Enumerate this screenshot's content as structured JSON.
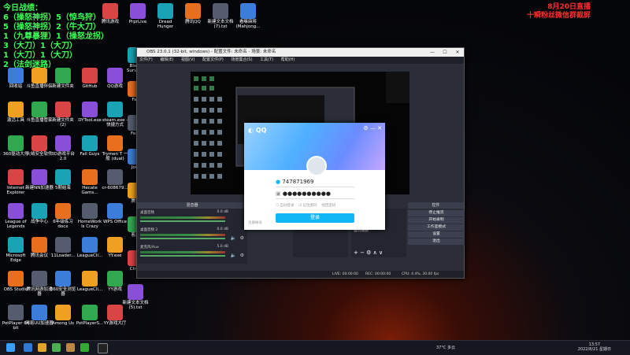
{
  "overlay": {
    "left_lines": [
      "今日战绩：",
      "6（操怒神拐）5（惊鸟狩）",
      "5（操怒神拐）2（牛大刀）",
      "1（九尊暴狸）1（操怒龙拐）",
      "3（大刀）1（大刀）",
      "1（大刀）1（大刀）",
      "2（法剑迷路）"
    ],
    "right_lines": [
      "8月20日直播",
      "十瞬粉丝微信群截屏"
    ]
  },
  "desktop": {
    "col1": [
      "回收站",
      "激活工具",
      "360驱动大师",
      "Internet Explorer",
      "League of Legends",
      "Microsoft Edge",
      "OBS Studio",
      "PotPlayer 64 bit"
    ],
    "col2": [
      "斗鱼直播伴侣",
      "斗鱼直播管家",
      "火绒安全软件",
      "新建NN加速器",
      "战争中心",
      "腾讯会议",
      "腾讯网游加速器",
      "网易UU加速器"
    ],
    "col3": [
      "新建文件夹",
      "新建文件夹 (2)",
      "3D游戏平台2.0",
      "5期结束",
      "6年级练习docx",
      "11Loader...",
      "360安全浏览器",
      "Among Us"
    ],
    "col4": [
      "GitHub",
      "DYTool.exe",
      "Fall Guys",
      "Hecate Gams...",
      "HomeWork Is Crazy",
      "LeagueCli...",
      "LeagueCli...",
      "PotPlayerS..."
    ],
    "col5": [
      "QQ游戏",
      "steam.exe - 快捷方式",
      "Trymen T 一般 (dual)",
      "cr-608679...",
      "WPS Office",
      "YY.exe",
      "YY游戏",
      "YY游戏大厅"
    ],
    "top_row": [
      "腾讯游戏",
      "PrprLive",
      "Dread Hunger",
      "腾讯QQ",
      "新建文本文档 (7).txt",
      "看嘛麻将(Mahjong..."
    ],
    "col6": [
      "Black Survival",
      "Fall",
      "Fear",
      "Jom",
      "腾讯",
      "客户",
      "Ctrl+",
      "新建文本文档 (5).txt"
    ],
    "col7": [
      "Pummel Party",
      "新建文本文档 (6).txt",
      "Google Chrome",
      "Riot Client"
    ]
  },
  "obs": {
    "title": "OBS 23.0.1 (32-bit, windows) - 配置文件: 未命名 - 场景: 未命名",
    "menu": [
      "文件(F)",
      "编辑(E)",
      "视图(V)",
      "配置文件(P)",
      "场景集合(S)",
      "工具(T)",
      "帮助(H)"
    ],
    "mixer_title": "混音器",
    "controls_title": "控件",
    "mixer_channels": [
      {
        "name": "桌面音频",
        "db": "0.0 dB"
      },
      {
        "name": "桌面音频 2",
        "db": "0.0 dB"
      },
      {
        "name": "麦克风/Aux",
        "db": "5.0 dB"
      }
    ],
    "sources": [
      "显示器捕获",
      "显示器捕获",
      "窗口捕获"
    ],
    "controls": [
      "停止推流",
      "开始录制",
      "工作室模式",
      "设置",
      "退出"
    ],
    "status": {
      "live": "LIVE: 00:00:00",
      "rec": "REC: 00:00:00",
      "cpu": "CPU: 4.4%, 30.00 fps"
    }
  },
  "qq": {
    "logo": "QQ",
    "account": "747871969",
    "password": "●●●●●●●●●●",
    "options": [
      "自动登录",
      "记住密码",
      "找回密码"
    ],
    "login": "登录",
    "register": "注册帐号"
  },
  "taskbar": {
    "weather": "37°C 多云",
    "time": "13:57",
    "date": "2022/8/21 星期日"
  },
  "colors": {
    "overlay_green": "#3cff58",
    "overlay_red": "#ff2d2d",
    "qq_button": "#12b7f5"
  }
}
